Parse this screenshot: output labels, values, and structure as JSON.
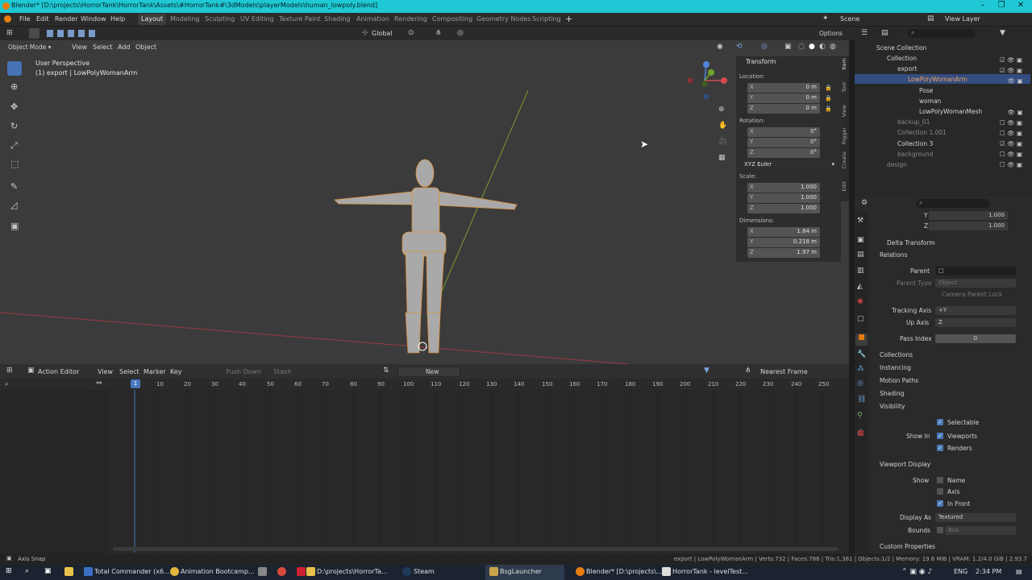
{
  "window": {
    "title": "Blender* [D:\\projects\\HorrorTank\\HorrorTank\\Assets\\#HorrorTank#\\3dModels\\playerModels\\human_lowpoly.blend]"
  },
  "menu": {
    "items": [
      "File",
      "Edit",
      "Render",
      "Window",
      "Help"
    ],
    "workspaces": [
      "Layout",
      "Modeling",
      "Sculpting",
      "UV Editing",
      "Texture Paint",
      "Shading",
      "Animation",
      "Rendering",
      "Compositing",
      "Geometry Nodes",
      "Scripting"
    ],
    "scene": "Scene",
    "view_layer": "View Layer"
  },
  "viewport": {
    "mode": "Object Mode",
    "menus": [
      "View",
      "Select",
      "Add",
      "Object"
    ],
    "orientation": "Global",
    "options": "Options",
    "perspective": "User Perspective",
    "object_info": "(1) export | LowPolyWomanArm"
  },
  "transform": {
    "title": "Transform",
    "location_label": "Location:",
    "rotation_label": "Rotation:",
    "scale_label": "Scale:",
    "dimensions_label": "Dimensions:",
    "location": [
      {
        "axis": "X",
        "value": "0 m"
      },
      {
        "axis": "Y",
        "value": "0 m"
      },
      {
        "axis": "Z",
        "value": "0 m"
      }
    ],
    "rotation": [
      {
        "axis": "X",
        "value": "0°"
      },
      {
        "axis": "Y",
        "value": "0°"
      },
      {
        "axis": "Z",
        "value": "0°"
      }
    ],
    "rotation_mode": "XYZ Euler",
    "scale": [
      {
        "axis": "X",
        "value": "1.000"
      },
      {
        "axis": "Y",
        "value": "1.000"
      },
      {
        "axis": "Z",
        "value": "1.000"
      }
    ],
    "dimensions": [
      {
        "axis": "X",
        "value": "1.84 m"
      },
      {
        "axis": "Y",
        "value": "0.218 m"
      },
      {
        "axis": "Z",
        "value": "1.97 m"
      }
    ]
  },
  "sidetabs": [
    "Item",
    "Tool",
    "View",
    "Rigger",
    "Create",
    "Edit"
  ],
  "action_editor": {
    "editor": "Action Editor",
    "menus": [
      "View",
      "Select",
      "Marker",
      "Key"
    ],
    "push_down": "Push Down",
    "stash": "Stash",
    "new": "New",
    "snap": "Nearest Frame",
    "current_frame": "1",
    "ticks": [
      "10",
      "20",
      "30",
      "40",
      "50",
      "60",
      "70",
      "80",
      "90",
      "100",
      "110",
      "120",
      "130",
      "140",
      "150",
      "160",
      "170",
      "180",
      "190",
      "200",
      "210",
      "220",
      "230",
      "240",
      "250"
    ]
  },
  "outliner": {
    "rows": [
      "Scene Collection",
      "Collection",
      "export",
      "LowPolyWomanArm",
      "Pose",
      "woman",
      "LowPolyWomanMesh",
      "backup_01",
      "Collection 1.001",
      "Collection 3",
      "background",
      "design"
    ]
  },
  "properties": {
    "scale_y": "1.000",
    "scale_z": "1.000",
    "delta_transform": "Delta Transform",
    "relations": "Relations",
    "parent": "Parent",
    "parent_type": "Parent Type",
    "parent_type_value": "Object",
    "camera_parent_lock": "Camera Parent Lock",
    "tracking_axis": "Tracking Axis",
    "tracking_axis_value": "+Y",
    "up_axis": "Up Axis",
    "up_axis_value": "Z",
    "pass_index": "Pass Index",
    "pass_index_value": "0",
    "collections": "Collections",
    "instancing": "Instancing",
    "motion_paths": "Motion Paths",
    "shading": "Shading",
    "visibility": "Visibility",
    "selectable": "Selectable",
    "show_in": "Show In",
    "viewports": "Viewports",
    "renders": "Renders",
    "viewport_display": "Viewport Display",
    "show": "Show",
    "name": "Name",
    "axis": "Axis",
    "in_front": "In Front",
    "display_as": "Display As",
    "display_as_value": "Textured",
    "bounds": "Bounds",
    "bounds_value": "Box",
    "custom_properties": "Custom Properties"
  },
  "status": {
    "left": "Axis Snap",
    "right": "export | LowPolyWomanArm | Verts:732 | Faces:786 | Tris:1,381 | Objects:1/2 | Memory: 19.6 MiB | VRAM: 1.2/4.0 GiB | 2.93.7"
  },
  "taskbar": {
    "apps": [
      "Total Commander (x6...",
      "Animation Bootcamp...",
      "D:\\projects\\HorrorTa...",
      "Steam",
      "BsgLauncher",
      "Blender* [D:\\projects\\...",
      "HorrorTank - levelTest..."
    ],
    "lang": "ENG",
    "time": "2:34 PM"
  }
}
